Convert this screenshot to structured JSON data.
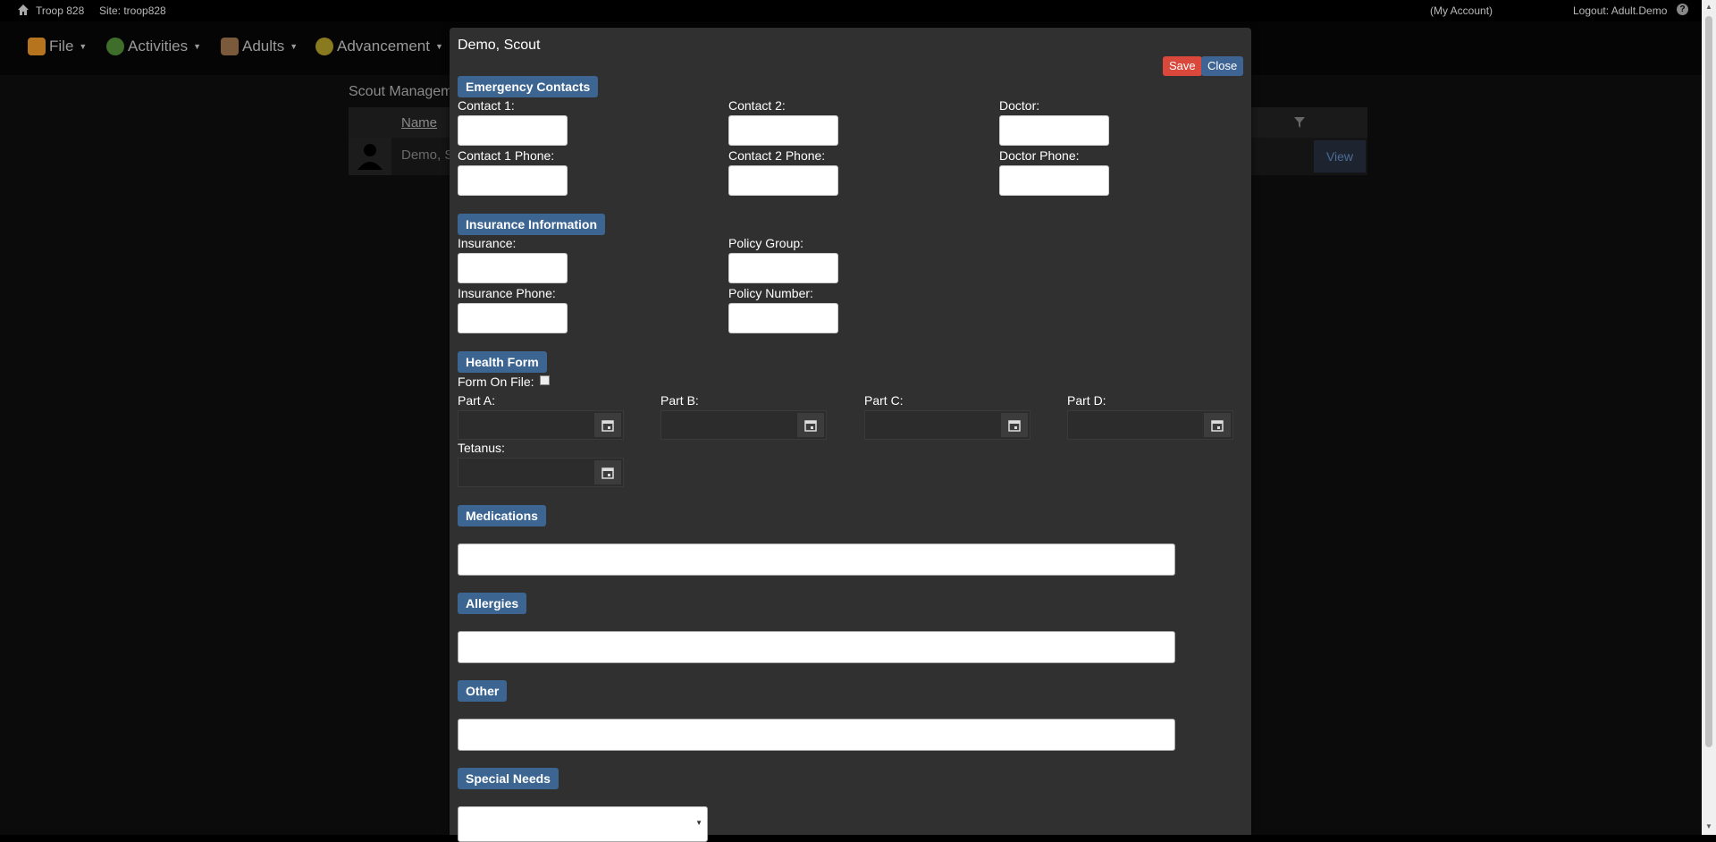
{
  "topbar": {
    "troop": "Troop 828",
    "site": "Site: troop828",
    "account": "(My Account)",
    "logout": "Logout: Adult.Demo",
    "help": "?"
  },
  "nav": {
    "items": [
      {
        "label": "File"
      },
      {
        "label": "Activities"
      },
      {
        "label": "Adults"
      },
      {
        "label": "Advancement"
      }
    ]
  },
  "background": {
    "title": "Scout Manageme",
    "column_name": "Name",
    "row_name": "Demo, S",
    "view_label": "View"
  },
  "modal": {
    "title": "Demo, Scout",
    "save_label": "Save",
    "close_label": "Close",
    "emergency": {
      "heading": "Emergency Contacts",
      "contact1": "Contact 1:",
      "contact2": "Contact 2:",
      "doctor": "Doctor:",
      "contact1_phone": "Contact 1 Phone:",
      "contact2_phone": "Contact 2 Phone:",
      "doctor_phone": "Doctor Phone:"
    },
    "insurance": {
      "heading": "Insurance Information",
      "insurance": "Insurance:",
      "policy_group": "Policy Group:",
      "insurance_phone": "Insurance Phone:",
      "policy_number": "Policy Number:"
    },
    "health": {
      "heading": "Health Form",
      "form_on_file": "Form On File:",
      "form_on_file_checked": false,
      "part_a": "Part A:",
      "part_b": "Part B:",
      "part_c": "Part C:",
      "part_d": "Part D:",
      "tetanus": "Tetanus:"
    },
    "medications": {
      "heading": "Medications",
      "value": ""
    },
    "allergies": {
      "heading": "Allergies",
      "value": ""
    },
    "other": {
      "heading": "Other",
      "value": ""
    },
    "special_needs": {
      "heading": "Special Needs",
      "selected": ""
    }
  },
  "colors": {
    "accent_blue": "#3c6592",
    "save_red": "#d9483b",
    "modal_bg": "#303030"
  }
}
